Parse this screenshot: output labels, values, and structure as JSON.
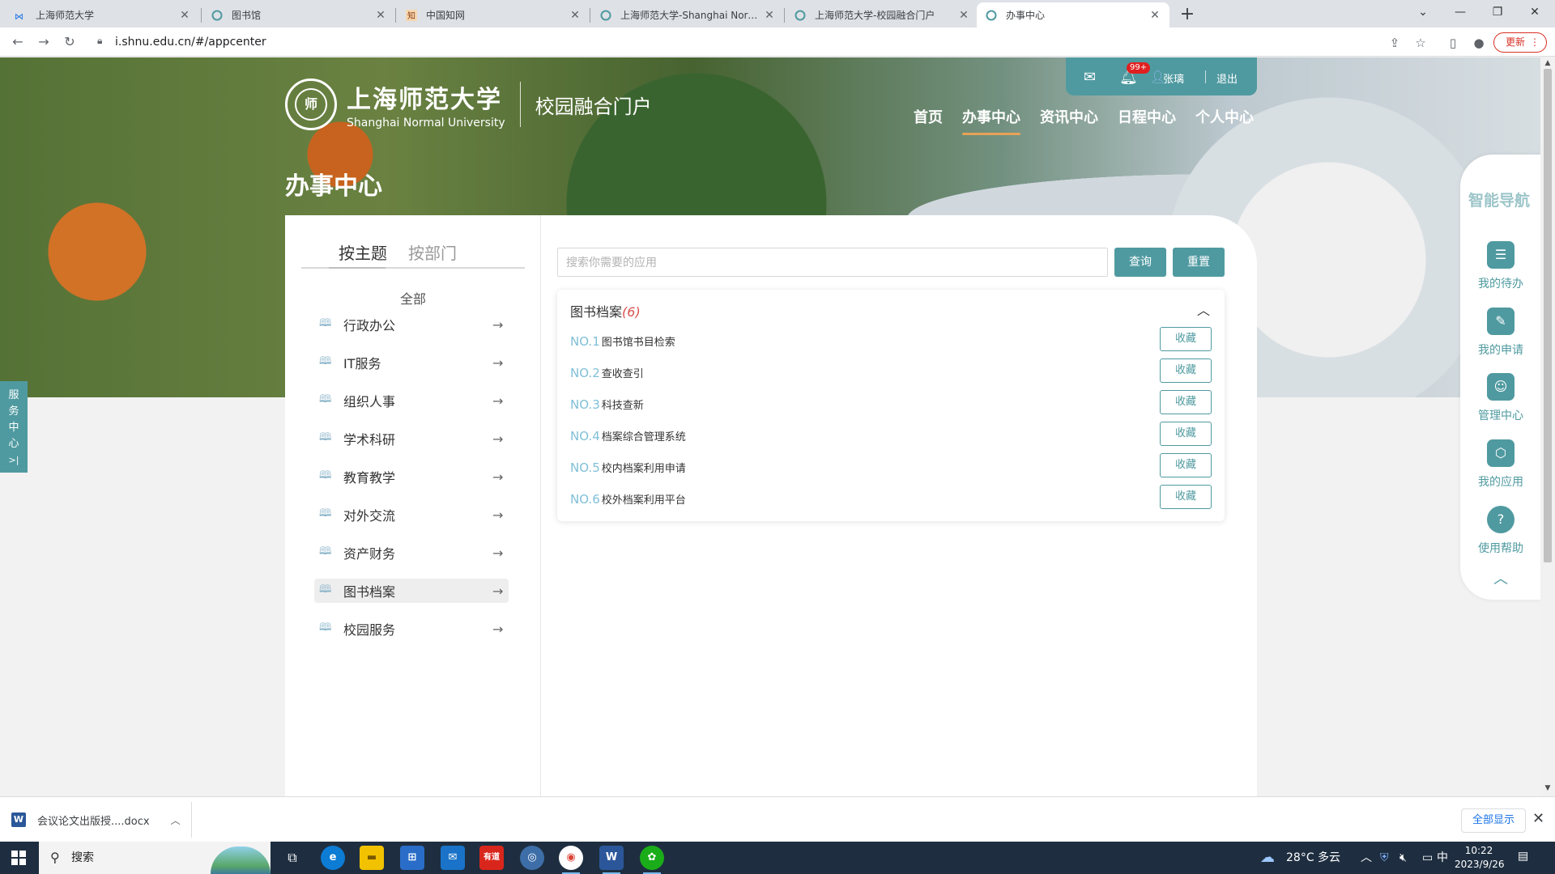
{
  "browser": {
    "tabs": [
      {
        "title": "上海师范大学"
      },
      {
        "title": "图书馆"
      },
      {
        "title": "中国知网"
      },
      {
        "title": "上海师范大学-Shanghai Norma"
      },
      {
        "title": "上海师范大学-校园融合门户"
      },
      {
        "title": "办事中心"
      }
    ],
    "url": "i.shnu.edu.cn/#/appcenter",
    "update_label": "更新"
  },
  "header": {
    "logo_cn": "上海师范大学",
    "logo_en": "Shanghai Normal University",
    "portal_name": "校园融合门户",
    "badge_count": "99+",
    "username": "张璃",
    "logout": "退出",
    "nav": [
      {
        "label": "首页"
      },
      {
        "label": "办事中心"
      },
      {
        "label": "资讯中心"
      },
      {
        "label": "日程中心"
      },
      {
        "label": "个人中心"
      }
    ],
    "page_title": "办事中心"
  },
  "service_tab": {
    "label": "服务中心"
  },
  "sidebar": {
    "seg_topic": "按主题",
    "seg_dept": "按部门",
    "all_label": "全部",
    "categories": [
      {
        "label": "行政办公"
      },
      {
        "label": "IT服务"
      },
      {
        "label": "组织人事"
      },
      {
        "label": "学术科研"
      },
      {
        "label": "教育教学"
      },
      {
        "label": "对外交流"
      },
      {
        "label": "资产财务"
      },
      {
        "label": "图书档案"
      },
      {
        "label": "校园服务"
      }
    ],
    "active_category": "图书档案"
  },
  "search": {
    "placeholder": "搜索你需要的应用",
    "query_label": "查询",
    "reset_label": "重置"
  },
  "panel": {
    "title": "图书档案",
    "count": "(6)",
    "fav_label": "收藏",
    "items": [
      {
        "no": "NO.1",
        "name": "图书馆书目检索"
      },
      {
        "no": "NO.2",
        "name": "查收查引"
      },
      {
        "no": "NO.3",
        "name": "科技查新"
      },
      {
        "no": "NO.4",
        "name": "档案综合管理系统"
      },
      {
        "no": "NO.5",
        "name": "校内档案利用申请"
      },
      {
        "no": "NO.6",
        "name": "校外档案利用平台"
      }
    ]
  },
  "smartnav": {
    "head": "智能导航",
    "items": [
      {
        "label": "我的待办"
      },
      {
        "label": "我的申请"
      },
      {
        "label": "管理中心"
      },
      {
        "label": "我的应用"
      },
      {
        "label": "使用帮助"
      }
    ]
  },
  "download": {
    "filename": "会议论文出版授....docx",
    "show_all": "全部显示"
  },
  "taskbar": {
    "search_label": "搜索",
    "weather": "28°C 多云",
    "ime": "中",
    "time": "10:22",
    "date": "2023/9/26"
  },
  "colors": {
    "accent": "#4f9aa0",
    "nav_underline": "#e7a257",
    "count_red": "#d9534f",
    "no_blue": "#7fbfd6"
  }
}
